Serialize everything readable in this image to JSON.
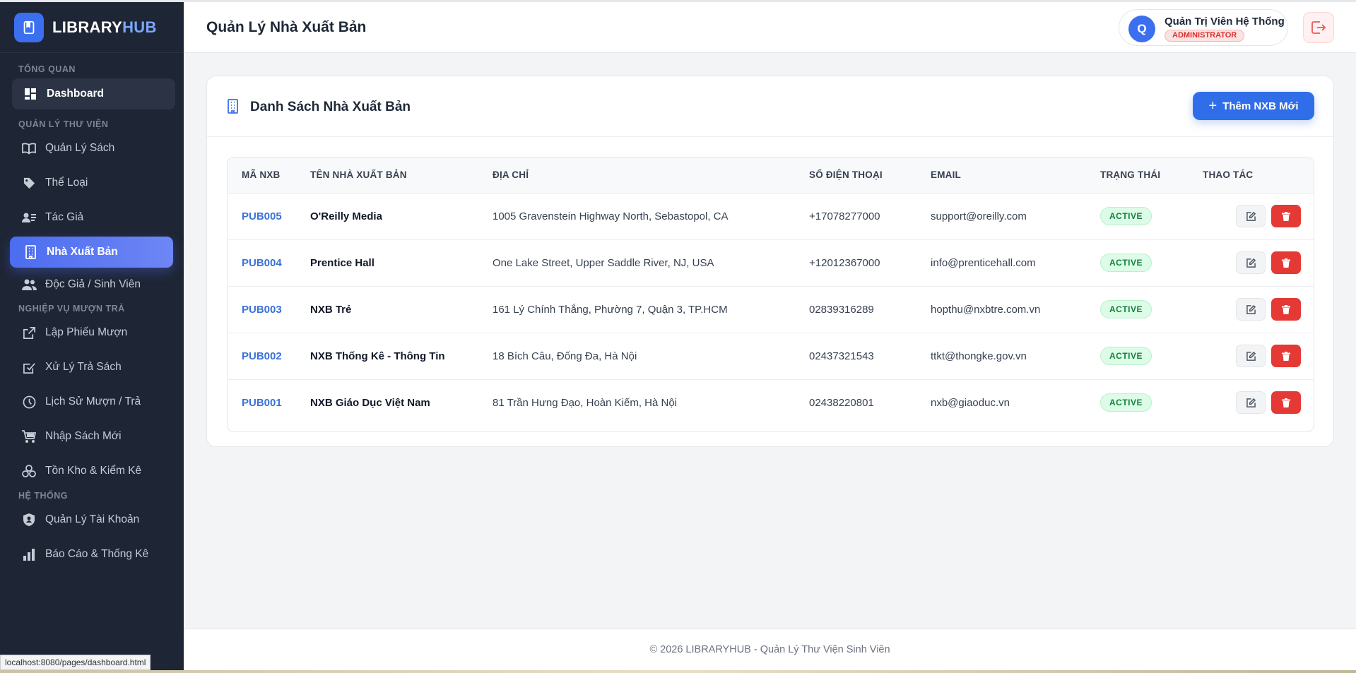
{
  "app": {
    "brand_prefix": "LIBRARY",
    "brand_suffix": "HUB"
  },
  "sidebar": {
    "sections": {
      "overview": "TỔNG QUAN",
      "library": "QUẢN LÝ THƯ VIỆN",
      "borrow": "NGHIỆP VỤ MƯỢN TRẢ",
      "system": "HỆ THỐNG"
    },
    "items": [
      {
        "label": "Dashboard",
        "icon": "dashboard-icon"
      },
      {
        "label": "Quản Lý Sách",
        "icon": "book-icon"
      },
      {
        "label": "Thể Loại",
        "icon": "tag-icon"
      },
      {
        "label": "Tác Giả",
        "icon": "user-card-icon"
      },
      {
        "label": "Nhà Xuất Bản",
        "icon": "building-icon"
      },
      {
        "label": "Độc Giả / Sinh Viên",
        "icon": "users-icon"
      },
      {
        "label": "Lập Phiếu Mượn",
        "icon": "external-link-icon"
      },
      {
        "label": "Xử Lý Trả Sách",
        "icon": "check-square-icon"
      },
      {
        "label": "Lịch Sử Mượn / Trả",
        "icon": "clock-icon"
      },
      {
        "label": "Nhập Sách Mới",
        "icon": "cart-icon"
      },
      {
        "label": "Tồn Kho & Kiểm Kê",
        "icon": "boxes-icon"
      },
      {
        "label": "Quản Lý Tài Khoản",
        "icon": "shield-icon"
      },
      {
        "label": "Báo Cáo & Thống Kê",
        "icon": "bar-chart-icon"
      }
    ],
    "active_item": "Nhà Xuất Bản"
  },
  "header": {
    "title": "Quản Lý Nhà Xuất Bản",
    "user": {
      "initial": "Q",
      "name": "Quản Trị Viên Hệ Thống",
      "role": "ADMINISTRATOR"
    }
  },
  "card": {
    "title": "Danh Sách Nhà Xuất Bản",
    "add_button": "Thêm NXB Mới"
  },
  "table": {
    "headers": [
      "MÃ NXB",
      "TÊN NHÀ XUẤT BẢN",
      "ĐỊA CHỈ",
      "SỐ ĐIỆN THOẠI",
      "EMAIL",
      "TRẠNG THÁI",
      "THAO TÁC"
    ],
    "rows": [
      {
        "id": "PUB005",
        "name": "O'Reilly Media",
        "address": "1005 Gravenstein Highway North, Sebastopol, CA",
        "phone": "+17078277000",
        "email": "support@oreilly.com",
        "status": "ACTIVE"
      },
      {
        "id": "PUB004",
        "name": "Prentice Hall",
        "address": "One Lake Street, Upper Saddle River, NJ, USA",
        "phone": "+12012367000",
        "email": "info@prenticehall.com",
        "status": "ACTIVE"
      },
      {
        "id": "PUB003",
        "name": "NXB Trẻ",
        "address": "161 Lý Chính Thắng, Phường 7, Quận 3, TP.HCM",
        "phone": "02839316289",
        "email": "hopthu@nxbtre.com.vn",
        "status": "ACTIVE"
      },
      {
        "id": "PUB002",
        "name": "NXB Thống Kê - Thông Tin",
        "address": "18 Bích Câu, Đống Đa, Hà Nội",
        "phone": "02437321543",
        "email": "ttkt@thongke.gov.vn",
        "status": "ACTIVE"
      },
      {
        "id": "PUB001",
        "name": "NXB Giáo Dục Việt Nam",
        "address": "81 Trần Hưng Đạo, Hoàn Kiếm, Hà Nội",
        "phone": "02438220801",
        "email": "nxb@giaoduc.vn",
        "status": "ACTIVE"
      }
    ]
  },
  "footer": {
    "text": "© 2026 LIBRARYHUB - Quản Lý Thư Viện Sinh Viên"
  },
  "browser": {
    "status_url": "localhost:8080/pages/dashboard.html"
  },
  "colors": {
    "sidebar": "#1e2535",
    "accent": "#3b6ff0",
    "active_badge": "#15803d",
    "delete": "#e53935"
  }
}
